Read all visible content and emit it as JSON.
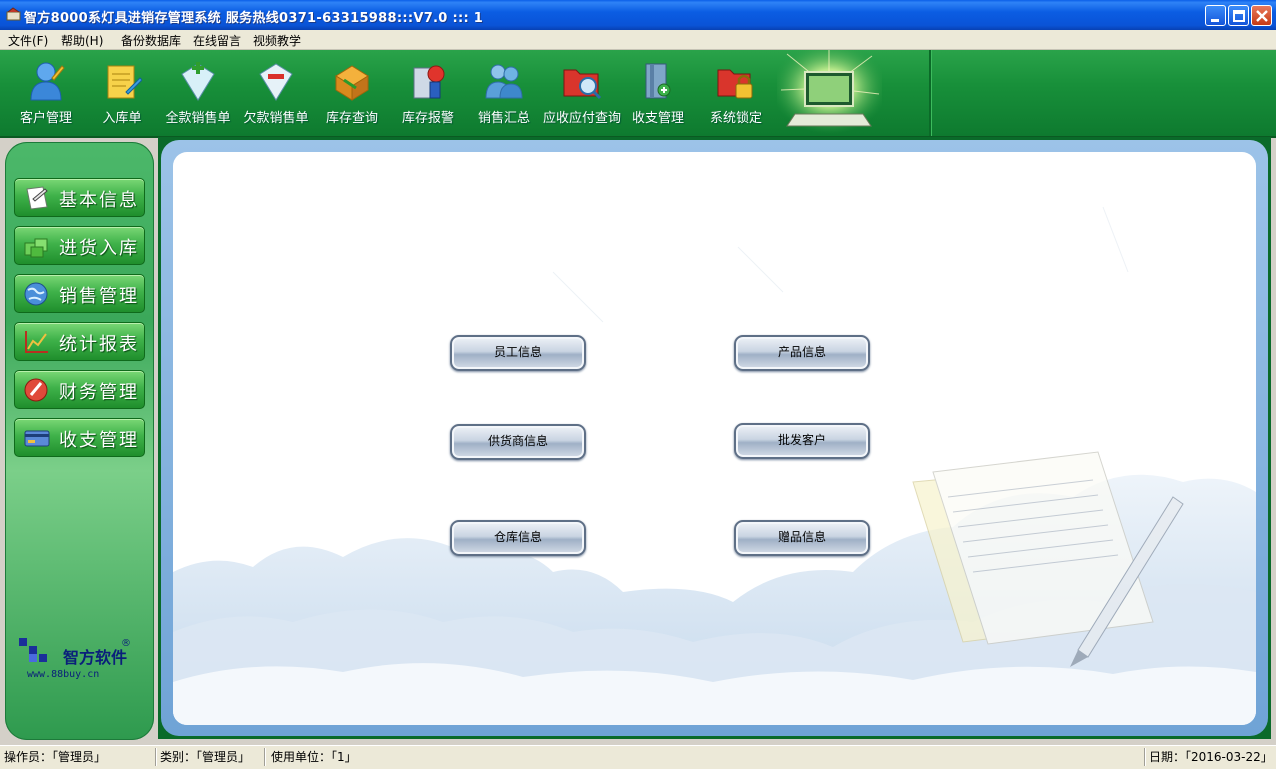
{
  "window": {
    "title": "智方8000系灯具进销存管理系统 服务热线0371-63315988:::V7.0 ::: 1"
  },
  "menu": {
    "file": "文件(F)",
    "help": "帮助(H)",
    "backup": "备份数据库",
    "message": "在线留言",
    "video": "视频教学"
  },
  "toolbar": {
    "items": [
      {
        "label": "客户管理",
        "icon": "customer-icon"
      },
      {
        "label": "入库单",
        "icon": "notepad-icon"
      },
      {
        "label": "全款销售单",
        "icon": "add-doc-icon"
      },
      {
        "label": "欠款销售单",
        "icon": "minus-doc-icon"
      },
      {
        "label": "库存查询",
        "icon": "box-icon"
      },
      {
        "label": "库存报警",
        "icon": "alarm-icon"
      },
      {
        "label": "销售汇总",
        "icon": "users-icon"
      },
      {
        "label": "应收应付查询",
        "icon": "folder-search-icon"
      },
      {
        "label": "收支管理",
        "icon": "book-icon"
      },
      {
        "label": "系统锁定",
        "icon": "lock-folder-icon"
      }
    ]
  },
  "sidebar": {
    "items": [
      {
        "label": "基本信息",
        "icon": "document-icon"
      },
      {
        "label": "进货入库",
        "icon": "boxes-icon"
      },
      {
        "label": "销售管理",
        "icon": "globe-icon"
      },
      {
        "label": "统计报表",
        "icon": "chart-icon"
      },
      {
        "label": "财务管理",
        "icon": "finance-icon"
      },
      {
        "label": "收支管理",
        "icon": "card-icon"
      }
    ],
    "brand_name": "智方软件",
    "brand_mark": "®",
    "brand_url": "www.88buy.cn"
  },
  "main": {
    "buttons": {
      "staff": "员工信息",
      "product": "产品信息",
      "supplier": "供货商信息",
      "wholesale": "批发客户",
      "warehouse": "仓库信息",
      "gift": "赠品信息"
    }
  },
  "status": {
    "operator": "操作员：「管理员」",
    "category": "类别：「管理员」",
    "unit": "使用单位：「1」",
    "date": "日期：「2016-03-22」"
  },
  "colors": {
    "toolbar_green": "#18903a",
    "title_blue": "#0a5ee8",
    "panel_border_blue": "#6fa3d6"
  }
}
